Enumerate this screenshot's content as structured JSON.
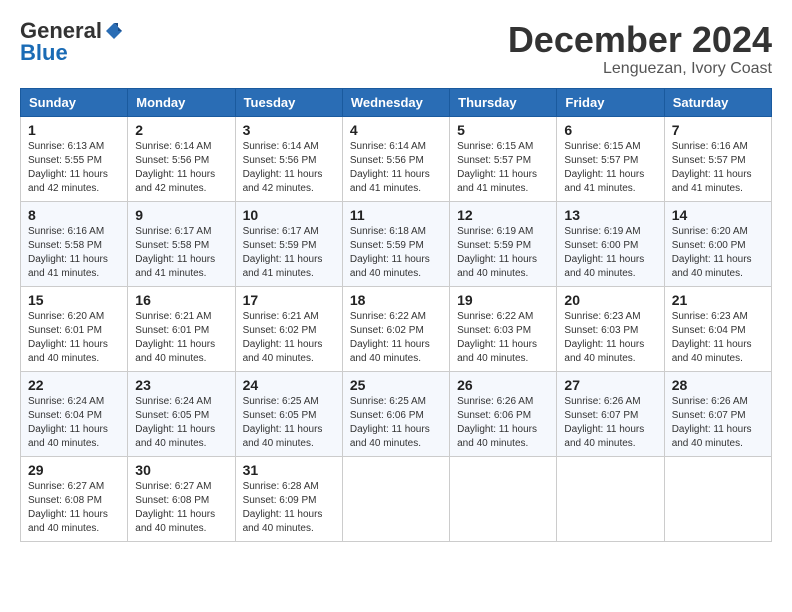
{
  "logo": {
    "general": "General",
    "blue": "Blue"
  },
  "title": {
    "month": "December 2024",
    "location": "Lenguezan, Ivory Coast"
  },
  "weekdays": [
    "Sunday",
    "Monday",
    "Tuesday",
    "Wednesday",
    "Thursday",
    "Friday",
    "Saturday"
  ],
  "weeks": [
    [
      {
        "day": 1,
        "sunrise": "6:13 AM",
        "sunset": "5:55 PM",
        "daylight": "11 hours and 42 minutes."
      },
      {
        "day": 2,
        "sunrise": "6:14 AM",
        "sunset": "5:56 PM",
        "daylight": "11 hours and 42 minutes."
      },
      {
        "day": 3,
        "sunrise": "6:14 AM",
        "sunset": "5:56 PM",
        "daylight": "11 hours and 42 minutes."
      },
      {
        "day": 4,
        "sunrise": "6:14 AM",
        "sunset": "5:56 PM",
        "daylight": "11 hours and 41 minutes."
      },
      {
        "day": 5,
        "sunrise": "6:15 AM",
        "sunset": "5:57 PM",
        "daylight": "11 hours and 41 minutes."
      },
      {
        "day": 6,
        "sunrise": "6:15 AM",
        "sunset": "5:57 PM",
        "daylight": "11 hours and 41 minutes."
      },
      {
        "day": 7,
        "sunrise": "6:16 AM",
        "sunset": "5:57 PM",
        "daylight": "11 hours and 41 minutes."
      }
    ],
    [
      {
        "day": 8,
        "sunrise": "6:16 AM",
        "sunset": "5:58 PM",
        "daylight": "11 hours and 41 minutes."
      },
      {
        "day": 9,
        "sunrise": "6:17 AM",
        "sunset": "5:58 PM",
        "daylight": "11 hours and 41 minutes."
      },
      {
        "day": 10,
        "sunrise": "6:17 AM",
        "sunset": "5:59 PM",
        "daylight": "11 hours and 41 minutes."
      },
      {
        "day": 11,
        "sunrise": "6:18 AM",
        "sunset": "5:59 PM",
        "daylight": "11 hours and 40 minutes."
      },
      {
        "day": 12,
        "sunrise": "6:19 AM",
        "sunset": "5:59 PM",
        "daylight": "11 hours and 40 minutes."
      },
      {
        "day": 13,
        "sunrise": "6:19 AM",
        "sunset": "6:00 PM",
        "daylight": "11 hours and 40 minutes."
      },
      {
        "day": 14,
        "sunrise": "6:20 AM",
        "sunset": "6:00 PM",
        "daylight": "11 hours and 40 minutes."
      }
    ],
    [
      {
        "day": 15,
        "sunrise": "6:20 AM",
        "sunset": "6:01 PM",
        "daylight": "11 hours and 40 minutes."
      },
      {
        "day": 16,
        "sunrise": "6:21 AM",
        "sunset": "6:01 PM",
        "daylight": "11 hours and 40 minutes."
      },
      {
        "day": 17,
        "sunrise": "6:21 AM",
        "sunset": "6:02 PM",
        "daylight": "11 hours and 40 minutes."
      },
      {
        "day": 18,
        "sunrise": "6:22 AM",
        "sunset": "6:02 PM",
        "daylight": "11 hours and 40 minutes."
      },
      {
        "day": 19,
        "sunrise": "6:22 AM",
        "sunset": "6:03 PM",
        "daylight": "11 hours and 40 minutes."
      },
      {
        "day": 20,
        "sunrise": "6:23 AM",
        "sunset": "6:03 PM",
        "daylight": "11 hours and 40 minutes."
      },
      {
        "day": 21,
        "sunrise": "6:23 AM",
        "sunset": "6:04 PM",
        "daylight": "11 hours and 40 minutes."
      }
    ],
    [
      {
        "day": 22,
        "sunrise": "6:24 AM",
        "sunset": "6:04 PM",
        "daylight": "11 hours and 40 minutes."
      },
      {
        "day": 23,
        "sunrise": "6:24 AM",
        "sunset": "6:05 PM",
        "daylight": "11 hours and 40 minutes."
      },
      {
        "day": 24,
        "sunrise": "6:25 AM",
        "sunset": "6:05 PM",
        "daylight": "11 hours and 40 minutes."
      },
      {
        "day": 25,
        "sunrise": "6:25 AM",
        "sunset": "6:06 PM",
        "daylight": "11 hours and 40 minutes."
      },
      {
        "day": 26,
        "sunrise": "6:26 AM",
        "sunset": "6:06 PM",
        "daylight": "11 hours and 40 minutes."
      },
      {
        "day": 27,
        "sunrise": "6:26 AM",
        "sunset": "6:07 PM",
        "daylight": "11 hours and 40 minutes."
      },
      {
        "day": 28,
        "sunrise": "6:26 AM",
        "sunset": "6:07 PM",
        "daylight": "11 hours and 40 minutes."
      }
    ],
    [
      {
        "day": 29,
        "sunrise": "6:27 AM",
        "sunset": "6:08 PM",
        "daylight": "11 hours and 40 minutes."
      },
      {
        "day": 30,
        "sunrise": "6:27 AM",
        "sunset": "6:08 PM",
        "daylight": "11 hours and 40 minutes."
      },
      {
        "day": 31,
        "sunrise": "6:28 AM",
        "sunset": "6:09 PM",
        "daylight": "11 hours and 40 minutes."
      },
      null,
      null,
      null,
      null
    ]
  ],
  "labels": {
    "sunrise": "Sunrise:",
    "sunset": "Sunset:",
    "daylight": "Daylight:"
  }
}
